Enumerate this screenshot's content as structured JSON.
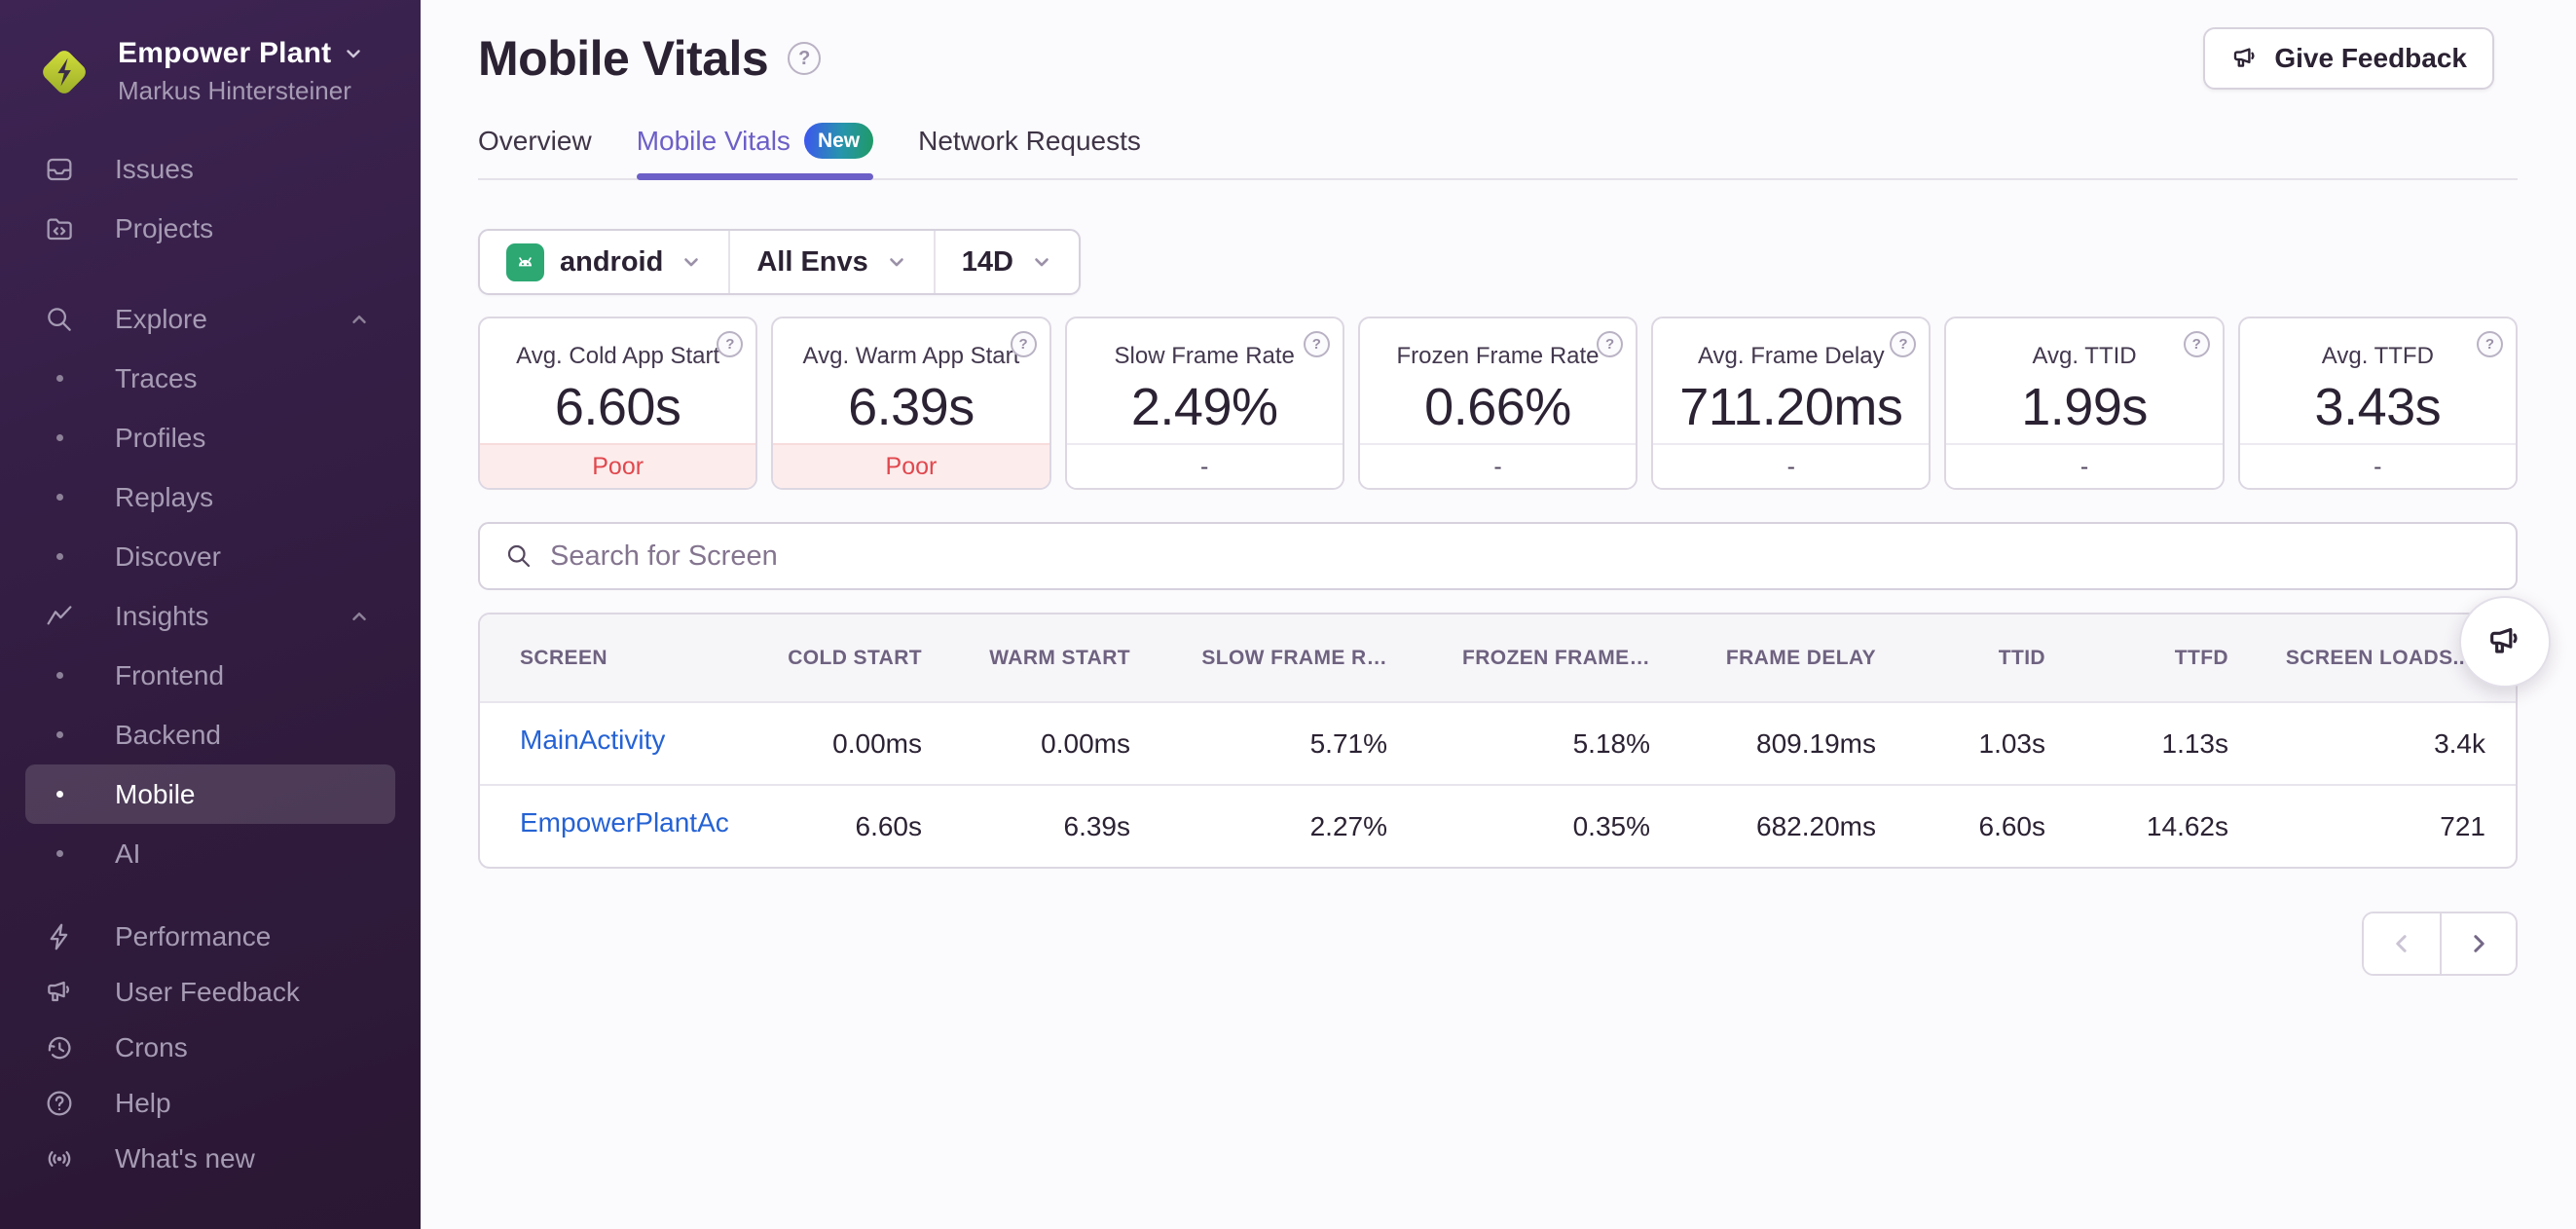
{
  "colors": {
    "accent_purple": "#6c5fc7",
    "link_blue": "#2562d4",
    "status_poor_red": "#e0484e",
    "status_poor_bg": "#fdecec",
    "android_green": "#2da873",
    "sidebar_purple": "#33203f",
    "new_badge_gradient_start": "#3d55f0",
    "new_badge_gradient_end": "#1f9a63"
  },
  "icons": {
    "help": "?",
    "names": [
      "org-logo-icon",
      "chevron-down-icon",
      "chevron-up-icon",
      "issues-icon",
      "projects-icon",
      "search-icon",
      "insights-icon",
      "lightning-icon",
      "megaphone-icon",
      "clock-history-icon",
      "help-circle-icon",
      "broadcast-icon",
      "android-icon",
      "sort-descending-icon",
      "chevron-left-icon",
      "chevron-right-icon",
      "bullet-icon"
    ]
  },
  "sidebar": {
    "org_name": "Empower Plant",
    "user_name": "Markus Hintersteiner",
    "items": [
      {
        "label": "Issues"
      },
      {
        "label": "Projects"
      },
      {
        "label": "Explore"
      },
      {
        "label": "Traces"
      },
      {
        "label": "Profiles"
      },
      {
        "label": "Replays"
      },
      {
        "label": "Discover"
      },
      {
        "label": "Insights"
      },
      {
        "label": "Frontend"
      },
      {
        "label": "Backend"
      },
      {
        "label": "Mobile"
      },
      {
        "label": "AI"
      },
      {
        "label": "Performance"
      },
      {
        "label": "User Feedback"
      },
      {
        "label": "Crons"
      },
      {
        "label": "Help"
      },
      {
        "label": "What's new"
      }
    ],
    "selected_item": "Mobile"
  },
  "header": {
    "title": "Mobile Vitals",
    "feedback_button": "Give Feedback"
  },
  "tabs": [
    {
      "label": "Overview"
    },
    {
      "label": "Mobile Vitals",
      "badge": "New",
      "active": true
    },
    {
      "label": "Network Requests"
    }
  ],
  "filters": {
    "project": "android",
    "environment": "All Envs",
    "date_range": "14D"
  },
  "vitals_cards": [
    {
      "title": "Avg. Cold App Start",
      "value": "6.60s",
      "status": "Poor"
    },
    {
      "title": "Avg. Warm App Start",
      "value": "6.39s",
      "status": "Poor"
    },
    {
      "title": "Slow Frame Rate",
      "value": "2.49%",
      "status": "-"
    },
    {
      "title": "Frozen Frame Rate",
      "value": "0.66%",
      "status": "-"
    },
    {
      "title": "Avg. Frame Delay",
      "value": "711.20ms",
      "status": "-"
    },
    {
      "title": "Avg. TTID",
      "value": "1.99s",
      "status": "-"
    },
    {
      "title": "Avg. TTFD",
      "value": "3.43s",
      "status": "-"
    }
  ],
  "search": {
    "placeholder": "Search for Screen"
  },
  "table": {
    "columns": [
      "SCREEN",
      "COLD START",
      "WARM START",
      "SLOW FRAME R…",
      "FROZEN FRAME…",
      "FRAME DELAY",
      "TTID",
      "TTFD",
      "SCREEN LOADS.."
    ],
    "sorted_column": "SCREEN LOADS",
    "sort_direction": "descending",
    "rows": [
      [
        "MainActivity",
        "0.00ms",
        "0.00ms",
        "5.71%",
        "5.18%",
        "809.19ms",
        "1.03s",
        "1.13s",
        "3.4k"
      ],
      [
        "EmpowerPlantAc",
        "6.60s",
        "6.39s",
        "2.27%",
        "0.35%",
        "682.20ms",
        "6.60s",
        "14.62s",
        "721"
      ]
    ]
  }
}
